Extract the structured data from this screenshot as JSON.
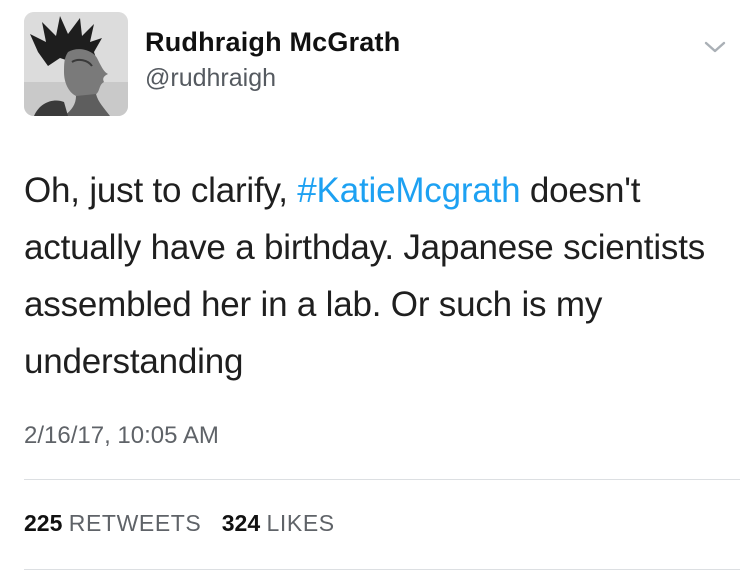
{
  "user": {
    "display_name": "Rudhraigh McGrath",
    "handle": "@rudhraigh"
  },
  "icons": {
    "more_menu": "chevron-down-icon",
    "avatar": "profile-photo"
  },
  "tweet": {
    "text_before": "Oh, just to clarify, ",
    "hashtag": "#KatieMcgrath",
    "text_after": " doesn't actually have a birthday. Japanese scientists assembled her in a lab. Or such is my understanding",
    "timestamp": "2/16/17, 10:05 AM"
  },
  "stats": {
    "retweets_count": "225",
    "retweets_label": "RETWEETS",
    "likes_count": "324",
    "likes_label": "LIKES"
  },
  "colors": {
    "hashtag": "#1da1f2",
    "secondary_text": "#5f6368",
    "divider": "#dcdfe2"
  }
}
